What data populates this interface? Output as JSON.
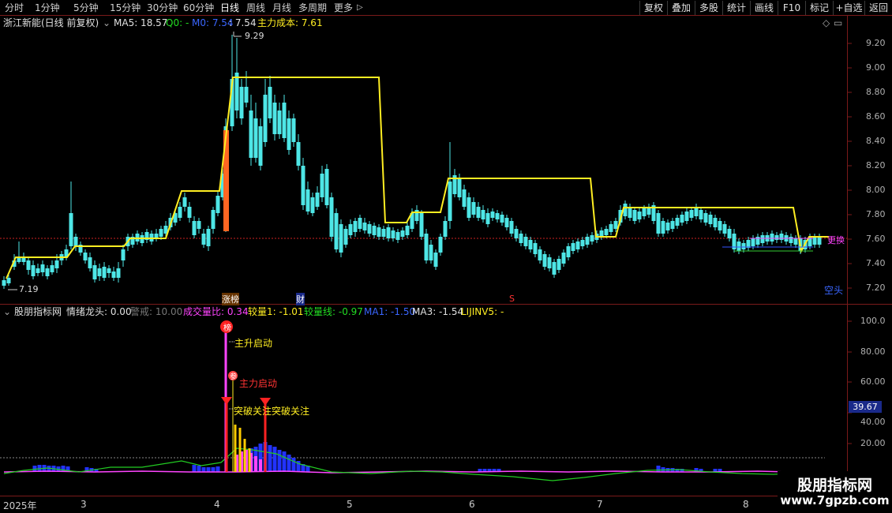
{
  "toolbar": {
    "timeframes": [
      "分时",
      "1分钟",
      "5分钟",
      "15分钟",
      "30分钟",
      "60分钟",
      "日线",
      "周线",
      "月线",
      "多周期",
      "更多"
    ],
    "active": "日线",
    "more_arrow": "▷",
    "right_buttons": [
      "复权",
      "叠加",
      "多股",
      "统计",
      "画线",
      "F10",
      "标记",
      "+自选",
      "返回"
    ]
  },
  "main": {
    "stock": "浙江新能(日线 前复权)",
    "ma5": "MA5: 18.57",
    "q0": "Q0: -",
    "m0": "M0: 7.54",
    "m0_extra": ": 7.54",
    "cost": "主力成本: 7.61",
    "high_label": "9.29",
    "low_label": "7.19",
    "price_levels": [
      "9.20",
      "9.00",
      "8.80",
      "8.60",
      "8.40",
      "8.20",
      "8.00",
      "7.80",
      "7.60",
      "7.40",
      "7.20"
    ],
    "markers": {
      "zhang": "涨榜",
      "cai": "财",
      "s": "S"
    },
    "kongtou": "空头",
    "duohuan": "更换"
  },
  "indicator": {
    "name": "股朋指标网",
    "qxlt": "情绪龙头: 0.00",
    "jingjie": "警戒: 10.00",
    "cjlb": "成交量比: 0.34",
    "jl1": "较量1: -1.01",
    "jlx": "较量线: -0.97",
    "ma1": "MA1: -1.50",
    "ma3": "MA3: -1.54",
    "lijinv5": "LIJINV5: -",
    "levels": [
      "100.0",
      "80.00",
      "60.00",
      "40.00",
      "20.00"
    ],
    "current_value": "39.67",
    "signals": {
      "bang": "榜",
      "zhushen": "主升启动",
      "zhuli": "主力启动",
      "tupo": "突破关注突破关注",
      "can": "参"
    }
  },
  "date_axis": {
    "year": "2025年",
    "months": [
      "3",
      "4",
      "5",
      "6",
      "7",
      "8"
    ]
  },
  "watermark": {
    "title": "股朋指标网",
    "url": "www.7gpzb.com"
  },
  "colors": {
    "up": "#ff3b3b",
    "down": "#4ee6e6",
    "cost_line": "#ffee22",
    "divider": "#7a1a1a",
    "magenta": "#ff44ff",
    "blue_bar": "#2233ff"
  }
}
